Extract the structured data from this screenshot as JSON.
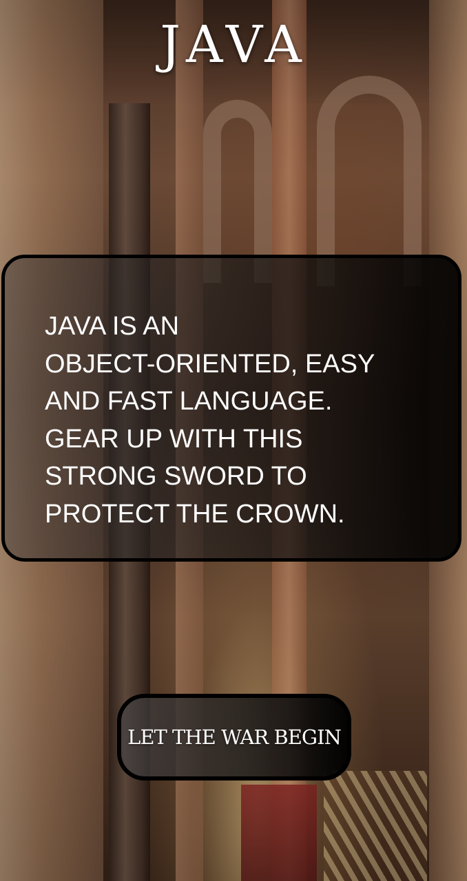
{
  "screen": {
    "title": "JAVA",
    "description": "JAVA IS AN\nOBJECT-ORIENTED, EASY\nAND FAST LANGUAGE.\nGEAR UP WITH THIS\nSTRONG SWORD TO\nPROTECT THE CROWN.",
    "action_button": {
      "label": "LET THE WAR BEGIN"
    }
  },
  "colors": {
    "text": "#ffffff",
    "card_border": "#000000"
  }
}
